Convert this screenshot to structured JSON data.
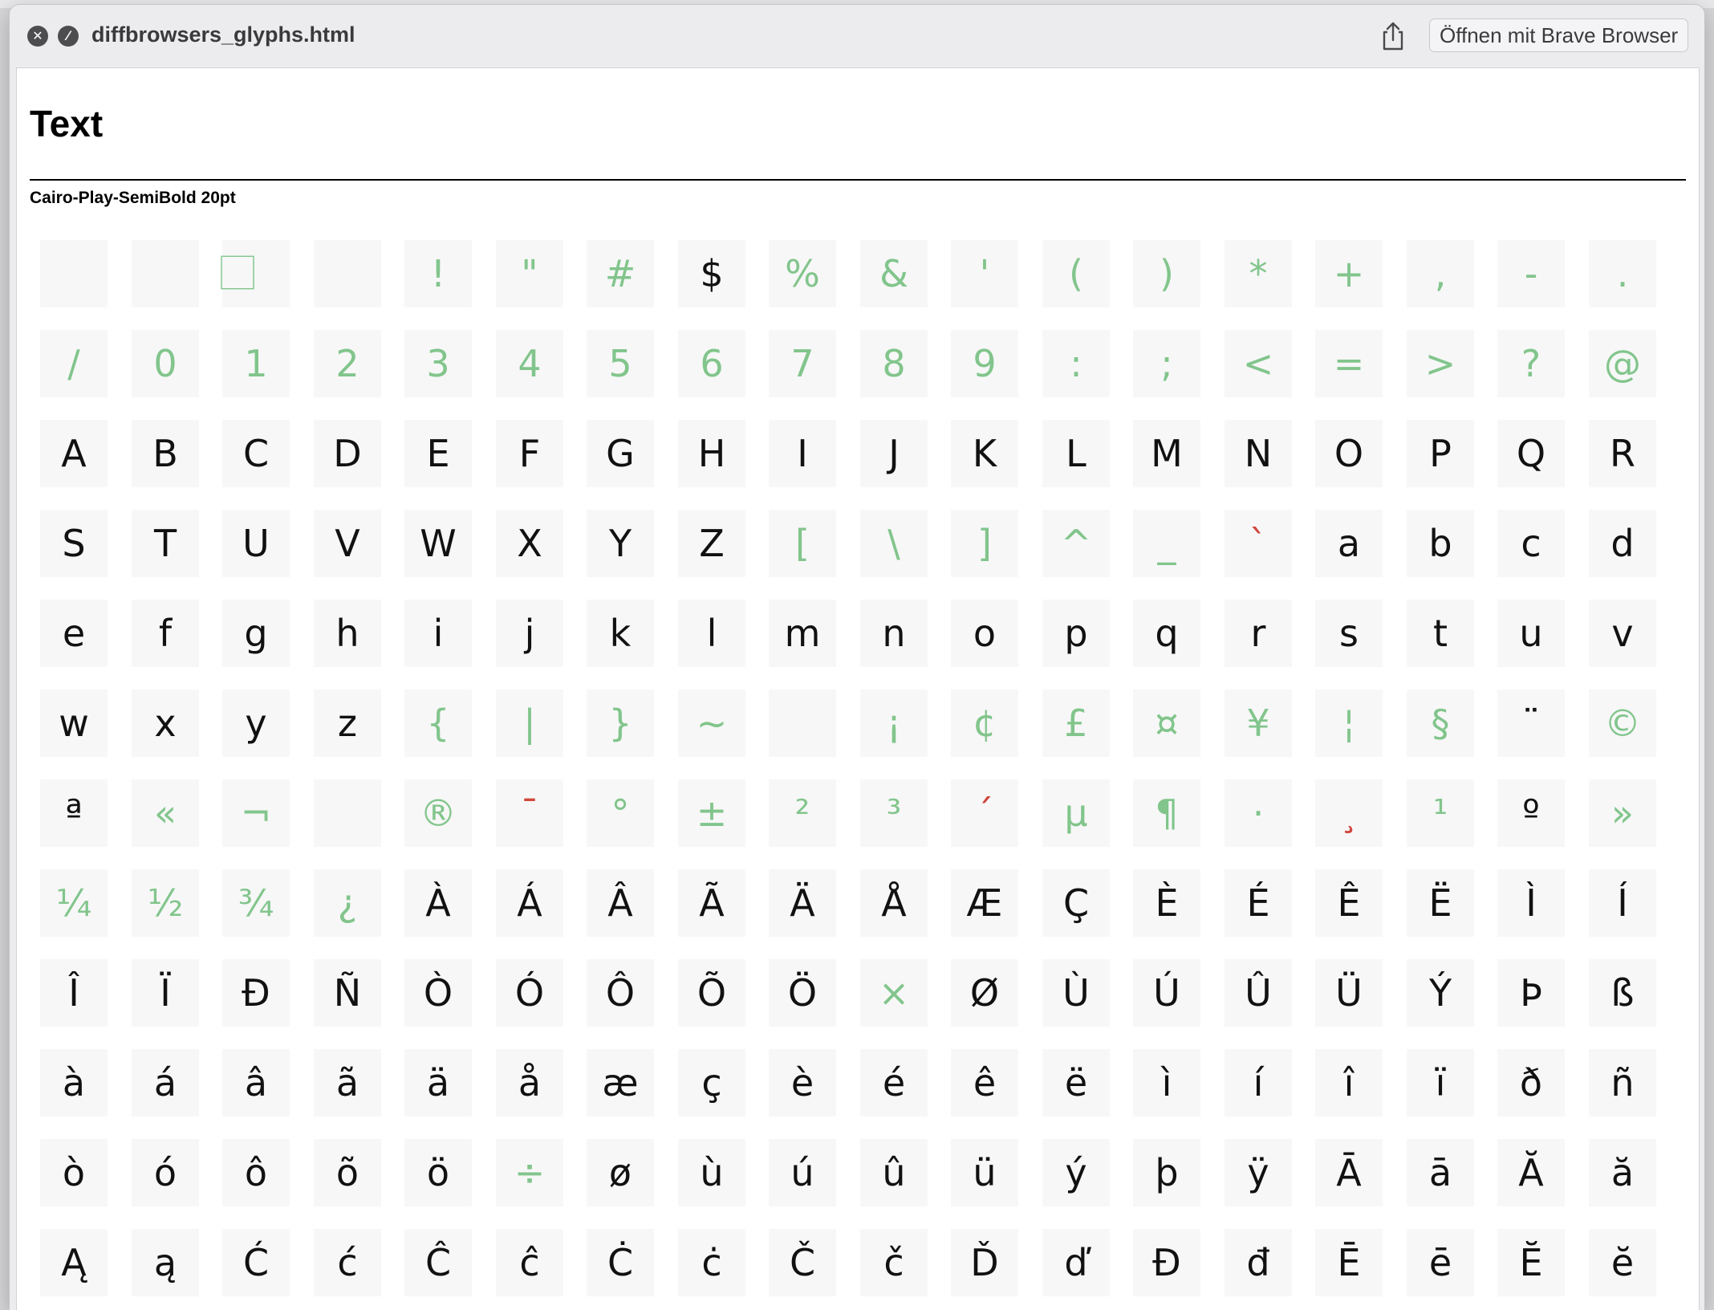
{
  "window": {
    "title": "diffbrowsers_glyphs.html",
    "open_button": "Öffnen mit Brave Browser",
    "close_icon": "close-icon",
    "minimize_icon": "minimize-icon",
    "share_icon": "share-icon"
  },
  "page": {
    "heading": "Text",
    "font_label": "Cairo-Play-SemiBold 20pt"
  },
  "colors": {
    "unchanged": "#111111",
    "changed_green": "#82c58c",
    "diff_red": "#d0463b"
  },
  "grid": {
    "columns": 18,
    "rows": [
      [
        " ",
        " ",
        "⃞",
        " ",
        "!",
        "\"",
        "#",
        "$",
        "%",
        "&",
        "'",
        "(",
        ")",
        "*",
        "+",
        ",",
        "-",
        "."
      ],
      [
        "/",
        "0",
        "1",
        "2",
        "3",
        "4",
        "5",
        "6",
        "7",
        "8",
        "9",
        ":",
        ";",
        "<",
        "=",
        ">",
        "?",
        "@"
      ],
      [
        "A",
        "B",
        "C",
        "D",
        "E",
        "F",
        "G",
        "H",
        "I",
        "J",
        "K",
        "L",
        "M",
        "N",
        "O",
        "P",
        "Q",
        "R"
      ],
      [
        "S",
        "T",
        "U",
        "V",
        "W",
        "X",
        "Y",
        "Z",
        "[",
        "\\",
        "]",
        "^",
        "_",
        "`",
        "a",
        "b",
        "c",
        "d"
      ],
      [
        "e",
        "f",
        "g",
        "h",
        "i",
        "j",
        "k",
        "l",
        "m",
        "n",
        "o",
        "p",
        "q",
        "r",
        "s",
        "t",
        "u",
        "v"
      ],
      [
        "w",
        "x",
        "y",
        "z",
        "{",
        "|",
        "}",
        "~",
        " ",
        "¡",
        "¢",
        "£",
        "¤",
        "¥",
        "¦",
        "§",
        "¨",
        "©"
      ],
      [
        "ª",
        "«",
        "¬",
        " ",
        "®",
        "¯",
        "°",
        "±",
        "²",
        "³",
        "´",
        "µ",
        "¶",
        "·",
        "¸",
        "¹",
        "º",
        "»"
      ],
      [
        "¼",
        "½",
        "¾",
        "¿",
        "À",
        "Á",
        "Â",
        "Ã",
        "Ä",
        "Å",
        "Æ",
        "Ç",
        "È",
        "É",
        "Ê",
        "Ë",
        "Ì",
        "Í"
      ],
      [
        "Î",
        "Ï",
        "Ð",
        "Ñ",
        "Ò",
        "Ó",
        "Ô",
        "Õ",
        "Ö",
        "×",
        "Ø",
        "Ù",
        "Ú",
        "Û",
        "Ü",
        "Ý",
        "Þ",
        "ß"
      ],
      [
        "à",
        "á",
        "â",
        "ã",
        "ä",
        "å",
        "æ",
        "ç",
        "è",
        "é",
        "ê",
        "ë",
        "ì",
        "í",
        "î",
        "ï",
        "ð",
        "ñ"
      ],
      [
        "ò",
        "ó",
        "ô",
        "õ",
        "ö",
        "÷",
        "ø",
        "ù",
        "ú",
        "û",
        "ü",
        "ý",
        "þ",
        "ÿ",
        "Ā",
        "ā",
        "Ă",
        "ă"
      ],
      [
        "Ą",
        "ą",
        "Ć",
        "ć",
        "Ĉ",
        "ĉ",
        "Ċ",
        "ċ",
        "Č",
        "č",
        "Ď",
        "ď",
        "Đ",
        "đ",
        "Ē",
        "ē",
        "Ĕ",
        "ĕ"
      ]
    ],
    "styles": [
      [
        "n",
        "n",
        "g",
        "n",
        "g",
        "g",
        "g",
        "b",
        "g",
        "g",
        "g",
        "g",
        "g",
        "g",
        "g",
        "g",
        "g",
        "g"
      ],
      [
        "g",
        "g",
        "g",
        "g",
        "g",
        "g",
        "g",
        "g",
        "g",
        "g",
        "g",
        "g",
        "g",
        "g",
        "g",
        "g",
        "g",
        "g"
      ],
      [
        "b",
        "b",
        "b",
        "b",
        "b",
        "b",
        "b",
        "b",
        "b",
        "b",
        "b",
        "b",
        "b",
        "b",
        "b",
        "b",
        "b",
        "b"
      ],
      [
        "b",
        "b",
        "b",
        "b",
        "b",
        "b",
        "b",
        "b",
        "g",
        "g",
        "g",
        "g",
        "g",
        "r",
        "b",
        "b",
        "b",
        "b"
      ],
      [
        "b",
        "b",
        "b",
        "b",
        "m",
        "m",
        "b",
        "b",
        "b",
        "b",
        "b",
        "b",
        "b",
        "b",
        "b",
        "b",
        "b",
        "b"
      ],
      [
        "b",
        "b",
        "b",
        "b",
        "g",
        "g",
        "g",
        "g",
        "n",
        "g",
        "g",
        "g",
        "g",
        "g",
        "g",
        "g",
        "m",
        "g"
      ],
      [
        "b",
        "g",
        "g",
        "n",
        "g",
        "r",
        "g",
        "g",
        "g",
        "g",
        "r",
        "g",
        "g",
        "g",
        "r",
        "g",
        "b",
        "g"
      ],
      [
        "g",
        "g",
        "g",
        "g",
        "m",
        "m",
        "m",
        "m",
        "m",
        "m",
        "b",
        "m",
        "m",
        "m",
        "m",
        "m",
        "m",
        "m"
      ],
      [
        "m",
        "m",
        "m",
        "m",
        "m",
        "m",
        "m",
        "m",
        "m",
        "g",
        "m",
        "m",
        "m",
        "m",
        "m",
        "m",
        "m",
        "b"
      ],
      [
        "m",
        "m",
        "m",
        "m",
        "m",
        "m",
        "b",
        "m",
        "m",
        "m",
        "m",
        "m",
        "m",
        "m",
        "m",
        "m",
        "m",
        "m"
      ],
      [
        "m",
        "m",
        "m",
        "m",
        "m",
        "g",
        "b",
        "m",
        "m",
        "m",
        "m",
        "m",
        "b",
        "m",
        "m",
        "m",
        "m",
        "m"
      ],
      [
        "m",
        "m",
        "m",
        "m",
        "m",
        "m",
        "m",
        "m",
        "m",
        "m",
        "m",
        "m",
        "m",
        "m",
        "m",
        "m",
        "m",
        "m"
      ]
    ]
  }
}
